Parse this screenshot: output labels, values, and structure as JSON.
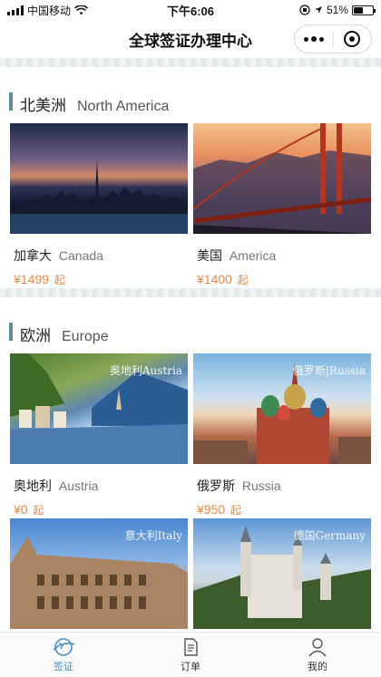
{
  "status_bar": {
    "carrier": "中国移动",
    "time": "下午6:06",
    "battery_text": "51%",
    "battery_level": 0.51
  },
  "nav": {
    "title": "全球签证办理中心"
  },
  "sections": [
    {
      "title_cn": "北美洲",
      "title_en": "North America",
      "countries": [
        {
          "name_cn": "加拿大",
          "name_en": "Canada",
          "price": "¥1499",
          "suffix": "起",
          "photo_label": ""
        },
        {
          "name_cn": "美国",
          "name_en": "America",
          "price": "¥1400",
          "suffix": "起",
          "photo_label": ""
        }
      ]
    },
    {
      "title_cn": "欧洲",
      "title_en": "Europe",
      "countries": [
        {
          "name_cn": "奥地利",
          "name_en": "Austria",
          "price": "¥0",
          "suffix": "起",
          "photo_label": "奥地利Austria"
        },
        {
          "name_cn": "俄罗斯",
          "name_en": "Russia",
          "price": "¥950",
          "suffix": "起",
          "photo_label": "俄罗斯|Russia"
        },
        {
          "name_cn": "",
          "name_en": "",
          "price": "",
          "suffix": "",
          "photo_label": "意大利Italy"
        },
        {
          "name_cn": "",
          "name_en": "",
          "price": "",
          "suffix": "",
          "photo_label": "德国Germany"
        }
      ]
    }
  ],
  "tab_bar": {
    "items": [
      {
        "label": "签证",
        "icon": "visa-globe-icon",
        "active": true
      },
      {
        "label": "订单",
        "icon": "order-document-icon",
        "active": false
      },
      {
        "label": "我的",
        "icon": "profile-person-icon",
        "active": false
      }
    ],
    "active_color": "#4a8fc9"
  }
}
